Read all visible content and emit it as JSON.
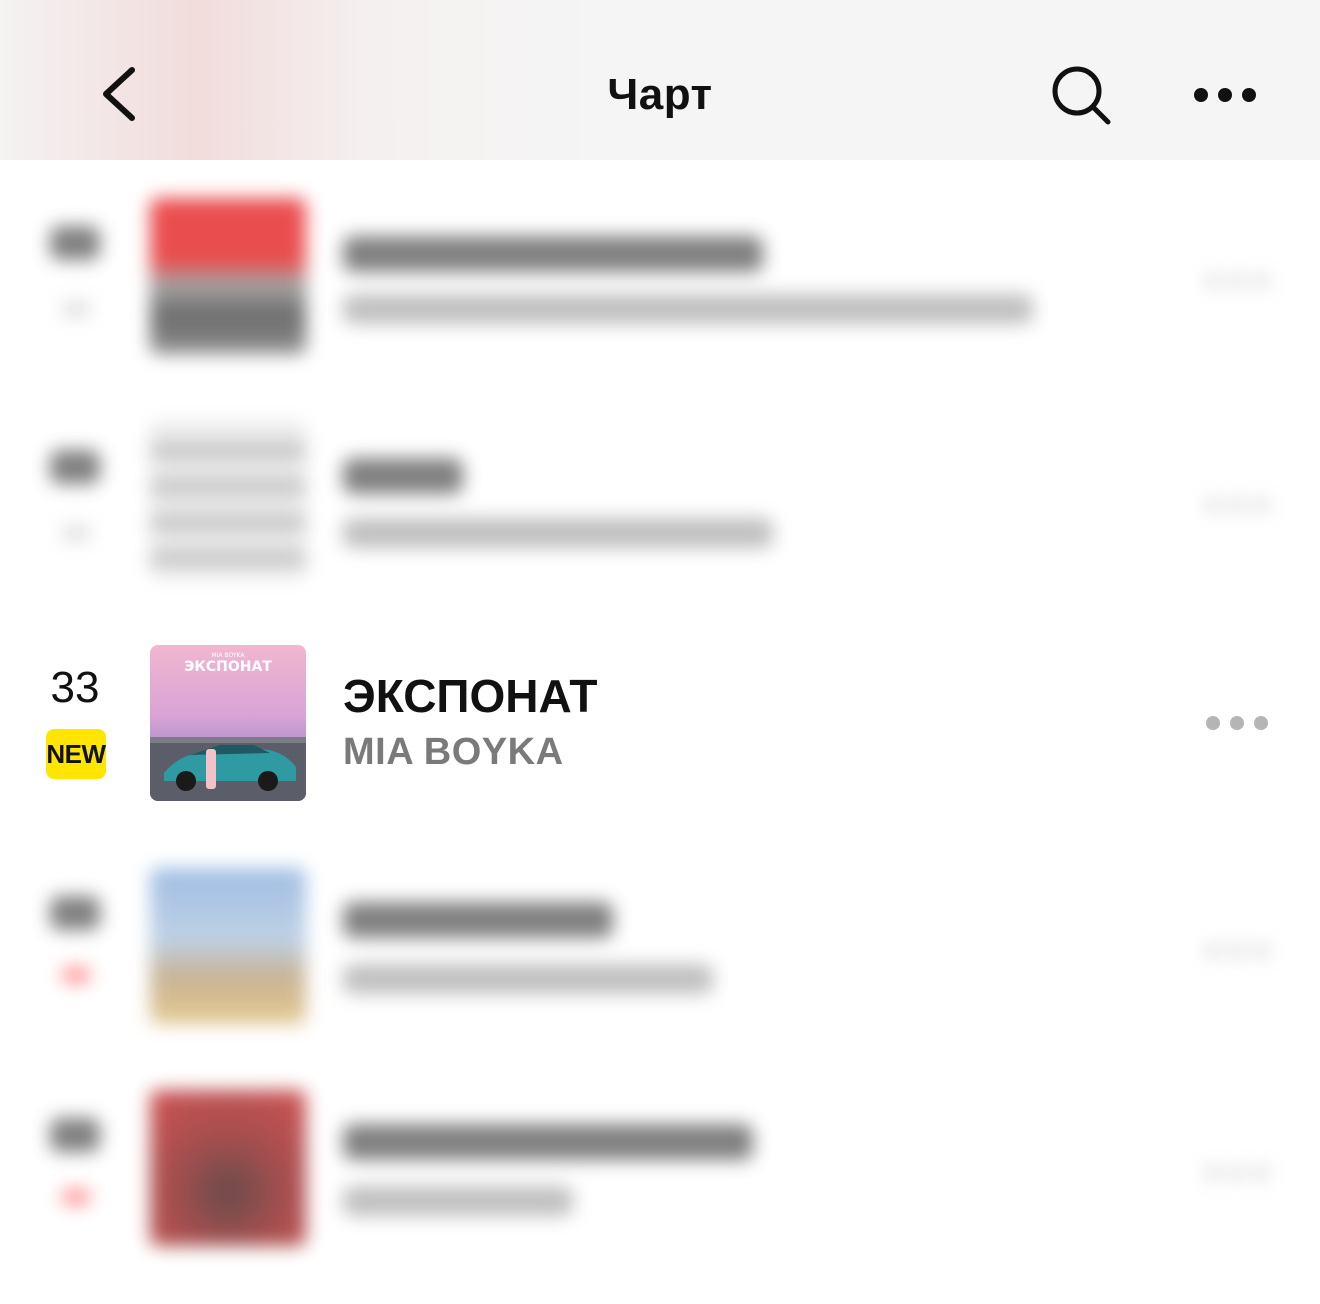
{
  "header": {
    "title": "Чарт",
    "back_icon": "chevron-left-icon",
    "search_icon": "search-icon",
    "more_icon": "more-horizontal-icon"
  },
  "tracks": [
    {
      "position": "33",
      "badge": "NEW",
      "title": "ЭКСПОНАТ",
      "artist": "MIA BOYKA",
      "cover_text": "ЭКСПОНАТ",
      "cover_subtext": "MIA BOYKA"
    }
  ],
  "colors": {
    "badge_new": "#ffe500",
    "artist_text": "#7a7a7a",
    "more_dots": "#b5b5b5"
  }
}
